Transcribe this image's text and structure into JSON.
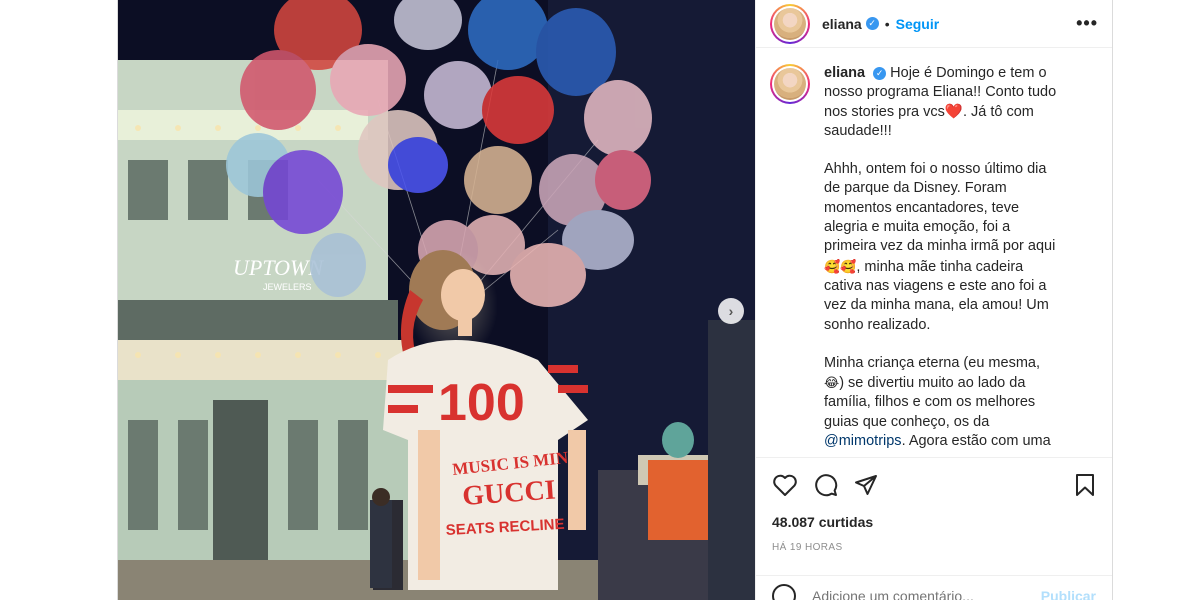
{
  "post": {
    "username": "eliana",
    "separator": "•",
    "follow_label": "Seguir",
    "more_label": "•••",
    "verified_label": "✓"
  },
  "caption": {
    "username": "eliana",
    "p1_text": "Hoje é Domingo e tem o nosso programa Eliana!! Conto tudo nos stories pra vcs",
    "p1_heart": "❤️",
    "p1_end": ". Já tô com saudade!!!",
    "p2_text": "Ahhh, ontem foi o nosso último dia de parque da Disney. Foram momentos encantadores, teve alegria e muita emoção, foi a primeira vez da minha irmã por aqui ",
    "p2_emoji": "🥰🥰",
    "p2_end": ", minha mãe tinha cadeira cativa nas viagens e este ano foi a vez da minha mana, ela amou! Um sonho realizado.",
    "p3_text": "Minha criança eterna (eu mesma, ",
    "p3_emoji": "😂",
    "p3_end": ") se divertiu muito ao lado da família, filhos e com os melhores guias que conheço, os da ",
    "mention": "@mimotrips",
    "p3_tail": ". Agora estão com uma"
  },
  "photo": {
    "sign_text": "UPTOWN",
    "sign_subtext": "JEWELERS",
    "shirt_number": "100",
    "shirt_line1": "MUSIC IS MINE",
    "shirt_line2": "GUCCI",
    "shirt_line3": "SEATS RECLINE",
    "next_arrow": "›"
  },
  "actions": {
    "likes": "48.087 curtidas",
    "timestamp": "HÁ 19 HORAS"
  },
  "comment": {
    "placeholder": "Adicione um comentário...",
    "publish_label": "Publicar"
  },
  "colors": {
    "accent": "#0095f6",
    "verified": "#3897f0",
    "shirt_red": "#d8322f"
  }
}
